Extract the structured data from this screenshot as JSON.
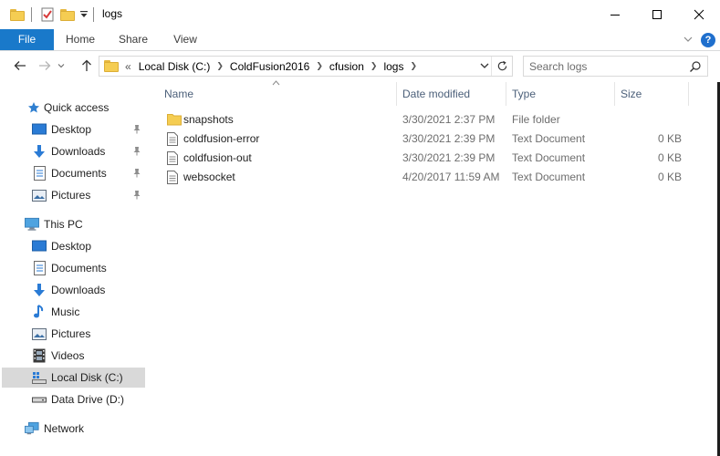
{
  "window": {
    "title": "logs"
  },
  "ribbon": {
    "tabs": [
      "File",
      "Home",
      "Share",
      "View"
    ]
  },
  "address": {
    "overflow": "«",
    "crumbs": [
      "Local Disk (C:)",
      "ColdFusion2016",
      "cfusion",
      "logs"
    ]
  },
  "search": {
    "placeholder": "Search logs"
  },
  "sidebar": {
    "quick_access": "Quick access",
    "quick_items": [
      "Desktop",
      "Downloads",
      "Documents",
      "Pictures"
    ],
    "this_pc": "This PC",
    "pc_items": [
      "Desktop",
      "Documents",
      "Downloads",
      "Music",
      "Pictures",
      "Videos",
      "Local Disk (C:)",
      "Data Drive (D:)"
    ],
    "network": "Network"
  },
  "columns": {
    "name": "Name",
    "date": "Date modified",
    "type": "Type",
    "size": "Size"
  },
  "files": [
    {
      "name": "snapshots",
      "date": "3/30/2021 2:37 PM",
      "type": "File folder",
      "size": "",
      "icon": "folder-icon"
    },
    {
      "name": "coldfusion-error",
      "date": "3/30/2021 2:39 PM",
      "type": "Text Document",
      "size": "0 KB",
      "icon": "text-file-icon"
    },
    {
      "name": "coldfusion-out",
      "date": "3/30/2021 2:39 PM",
      "type": "Text Document",
      "size": "0 KB",
      "icon": "text-file-icon"
    },
    {
      "name": "websocket",
      "date": "4/20/2017 11:59 AM",
      "type": "Text Document",
      "size": "0 KB",
      "icon": "text-file-icon"
    }
  ],
  "colors": {
    "accent": "#1979ca",
    "selected": "#cce8ff",
    "header_text": "#4c607a",
    "folder": "#f5cd52"
  }
}
